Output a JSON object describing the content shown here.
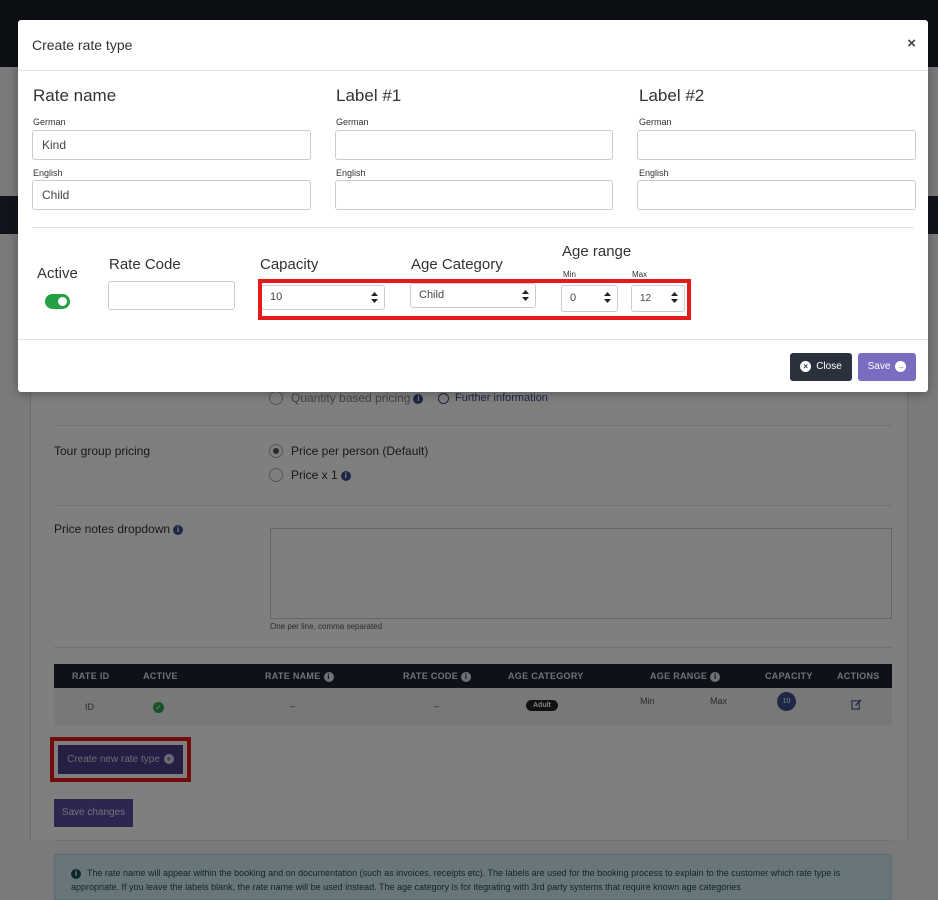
{
  "background": {
    "quantity_pricing_label": "Quantity based pricing",
    "further_information": "Further information",
    "tour_group_pricing_label": "Tour group pricing",
    "price_per_person": "Price per person (Default)",
    "price_x1": "Price x 1",
    "price_notes_label": "Price notes dropdown",
    "price_notes_hint": "One per line, comma separated",
    "table": {
      "headers": [
        "RATE ID",
        "ACTIVE",
        "RATE NAME",
        "RATE CODE",
        "AGE CATEGORY",
        "AGE RANGE",
        "CAPACITY",
        "ACTIONS"
      ],
      "row": {
        "rate_id": "ID",
        "rate_name": "–",
        "rate_code": "–",
        "age_category": "Adult",
        "age_min": "Min",
        "age_max": "Max",
        "capacity": "10"
      }
    },
    "create_new_rate_type": "Create new rate type",
    "save_changes": "Save changes",
    "info_text": "The rate name will appear within the booking and on documentation (such as invoices, receipts etc). The labels are used for the booking process to explain to the customer which rate type is appropriate. If you leave the labels blank, the rate name will be used instead. The age category is for itegrating with 3rd party systems that require known age categories"
  },
  "modal": {
    "title": "Create rate type",
    "close_symbol": "×",
    "rate_name": {
      "title": "Rate name",
      "german_label": "German",
      "german_value": "Kind",
      "english_label": "English",
      "english_value": "Child"
    },
    "label1": {
      "title": "Label #1",
      "german_label": "German",
      "german_value": "",
      "english_label": "English",
      "english_value": ""
    },
    "label2": {
      "title": "Label #2",
      "german_label": "German",
      "german_value": "",
      "english_label": "English",
      "english_value": ""
    },
    "active_label": "Active",
    "active": true,
    "rate_code_label": "Rate Code",
    "rate_code_value": "",
    "capacity_label": "Capacity",
    "capacity_value": "10",
    "age_category_label": "Age Category",
    "age_category_value": "Child",
    "age_range_label": "Age range",
    "age_min_label": "Min",
    "age_min_value": "0",
    "age_max_label": "Max",
    "age_max_value": "12",
    "close_button": "Close",
    "save_button": "Save"
  },
  "colors": {
    "accent": "#7a6cc0",
    "highlight": "#e31b1b",
    "toggle_on": "#24a142"
  }
}
